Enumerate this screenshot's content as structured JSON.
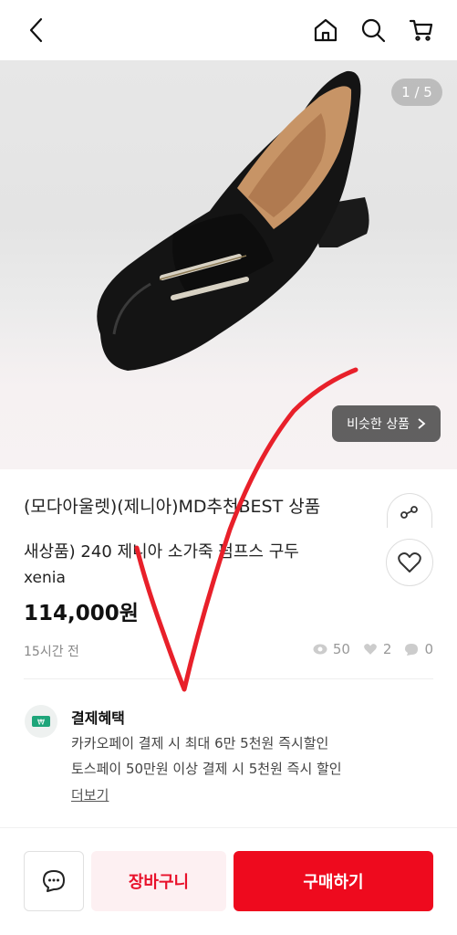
{
  "header": {
    "back_icon": "chevron-left-icon",
    "home_icon": "home-icon",
    "search_icon": "search-icon",
    "cart_icon": "cart-icon"
  },
  "gallery": {
    "counter": "1 / 5",
    "similar_label": "비슷한 상품"
  },
  "product": {
    "title_line1": "(모다아울렛)(제니아)MD추천BEST 상품",
    "title_line2": "새상품) 240 제니아 소가죽 펌프스 구두",
    "brand": "xenia",
    "price": "114,000원",
    "posted": "15시간 전",
    "stats": {
      "views": "50",
      "likes": "2",
      "chats": "0"
    }
  },
  "benefit": {
    "title": "결제혜택",
    "line1": "카카오페이 결제 시 최대 6만 5천원 즉시할인",
    "line2": "토스페이 50만원 이상 결제 시 5천원 즉시 할인",
    "more": "더보기"
  },
  "actions": {
    "cart": "장바구니",
    "buy": "구매하기"
  },
  "colors": {
    "accent": "#ee0a1e",
    "cart_bg": "#fdf0f2",
    "annotation": "#e8202a"
  }
}
